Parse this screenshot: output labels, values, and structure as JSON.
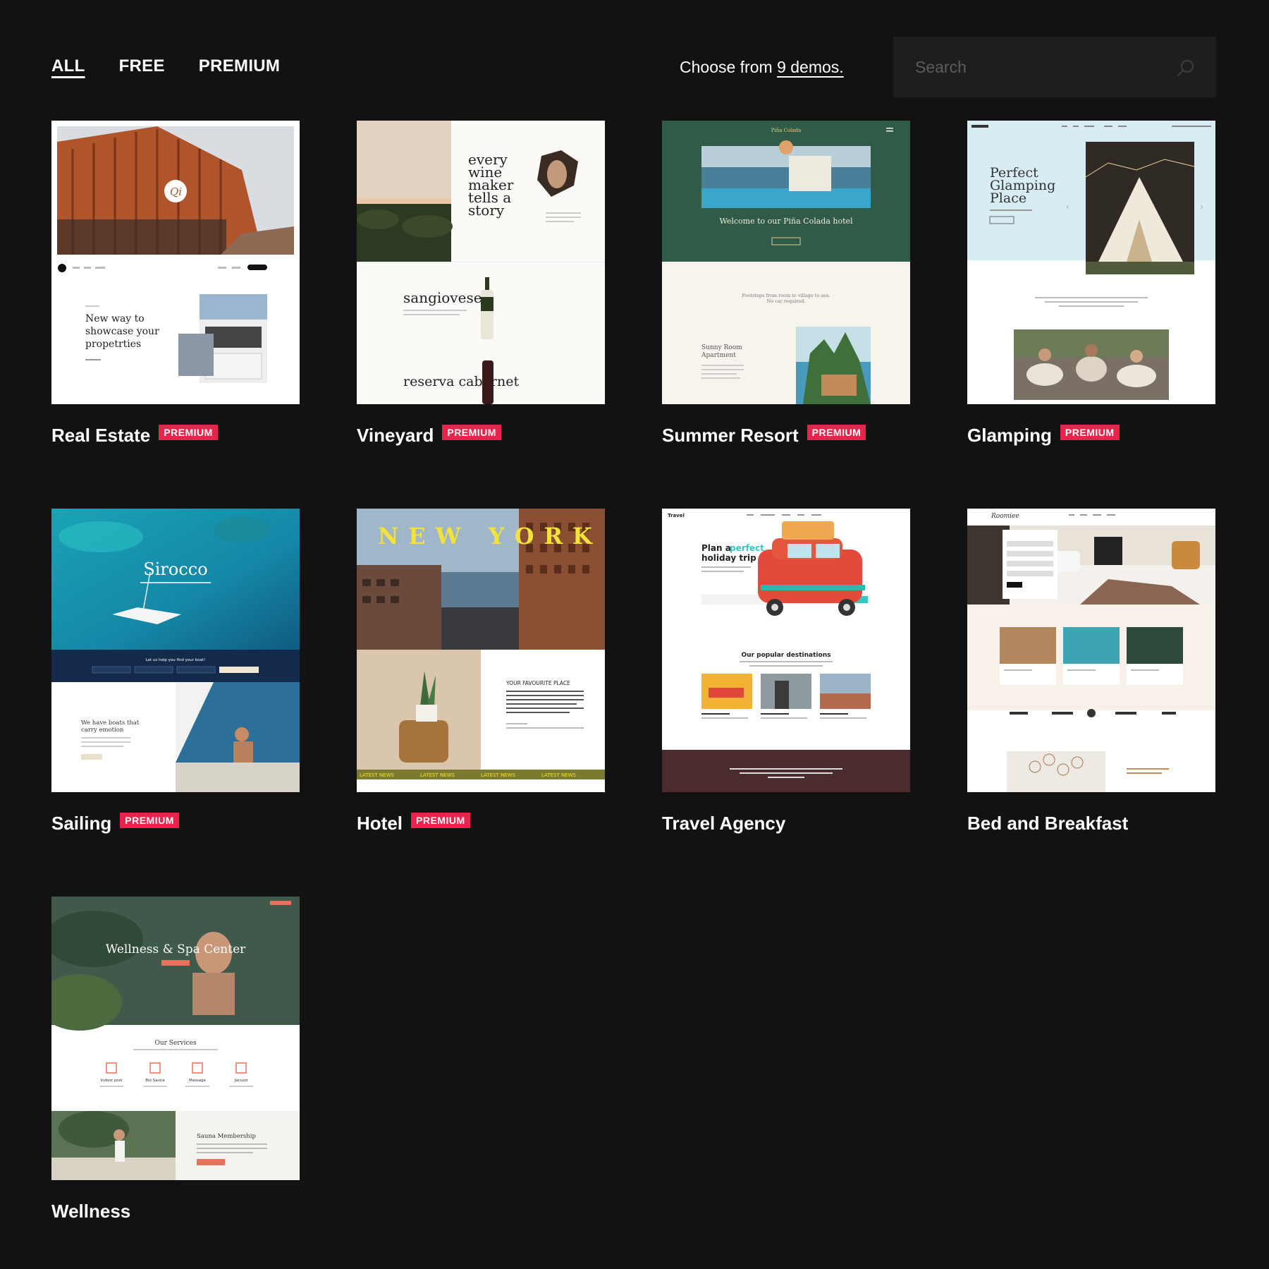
{
  "filters": [
    {
      "label": "ALL",
      "active": true
    },
    {
      "label": "FREE",
      "active": false
    },
    {
      "label": "PREMIUM",
      "active": false
    }
  ],
  "choose": {
    "prefix": "Choose from ",
    "link": "9 demos."
  },
  "search": {
    "placeholder": "Search",
    "icon": "search-icon"
  },
  "demos": [
    {
      "name": "Real Estate",
      "badge": "PREMIUM",
      "thumb": {
        "headline_1": "New way to",
        "headline_2": "showcase your",
        "headline_3": "propetrties",
        "logo": "Qi"
      }
    },
    {
      "name": "Vineyard",
      "badge": "PREMIUM",
      "thumb": {
        "line_1": "every",
        "line_2": "wine",
        "line_3": "maker",
        "line_4": "tells a",
        "line_5": "story",
        "wine_1": "sangiovese",
        "wine_2": "reserva cabernet"
      }
    },
    {
      "name": "Summer Resort",
      "badge": "PREMIUM",
      "thumb": {
        "brand": "Piña Colada",
        "welcome": "Welcome to our Piña Colada hotel",
        "sub_1": "Footsteps from room to village to sea.",
        "sub_2": "No car required.",
        "room_1": "Sunny Room",
        "room_2": "Apartment"
      }
    },
    {
      "name": "Glamping",
      "badge": "PREMIUM",
      "thumb": {
        "headline_1": "Perfect",
        "headline_2": "Glamping",
        "headline_3": "Place"
      }
    },
    {
      "name": "Sailing",
      "badge": "PREMIUM",
      "thumb": {
        "brand": "Sirocco",
        "search_prompt": "Let us help you find your boat!",
        "text_1": "We have boats that",
        "text_2": "carry emotion"
      }
    },
    {
      "name": "Hotel",
      "badge": "PREMIUM",
      "thumb": {
        "headline": "NEW YORK",
        "section": "YOUR FAVOURITE PLACE",
        "ticker": "LATEST NEWS"
      }
    },
    {
      "name": "Travel Agency",
      "badge": "",
      "thumb": {
        "brand": "Travel",
        "headline_1": "Plan a",
        "headline_accent": "perfect",
        "headline_2": "holiday trip",
        "section": "Our popular destinations"
      }
    },
    {
      "name": "Bed and Breakfast",
      "badge": "",
      "thumb": {
        "brand": "Roomiee"
      }
    },
    {
      "name": "Wellness",
      "badge": "",
      "thumb": {
        "headline": "Wellness & Spa Center",
        "section": "Our Services",
        "service_1": "Indoor pool",
        "service_2": "Bio Sauna",
        "service_3": "Massage",
        "service_4": "Jacuzzi",
        "membership": "Sauna Membership"
      }
    }
  ],
  "colors": {
    "background": "#121212",
    "badge": "#e8244d",
    "search_bg": "#1e1e1e"
  }
}
